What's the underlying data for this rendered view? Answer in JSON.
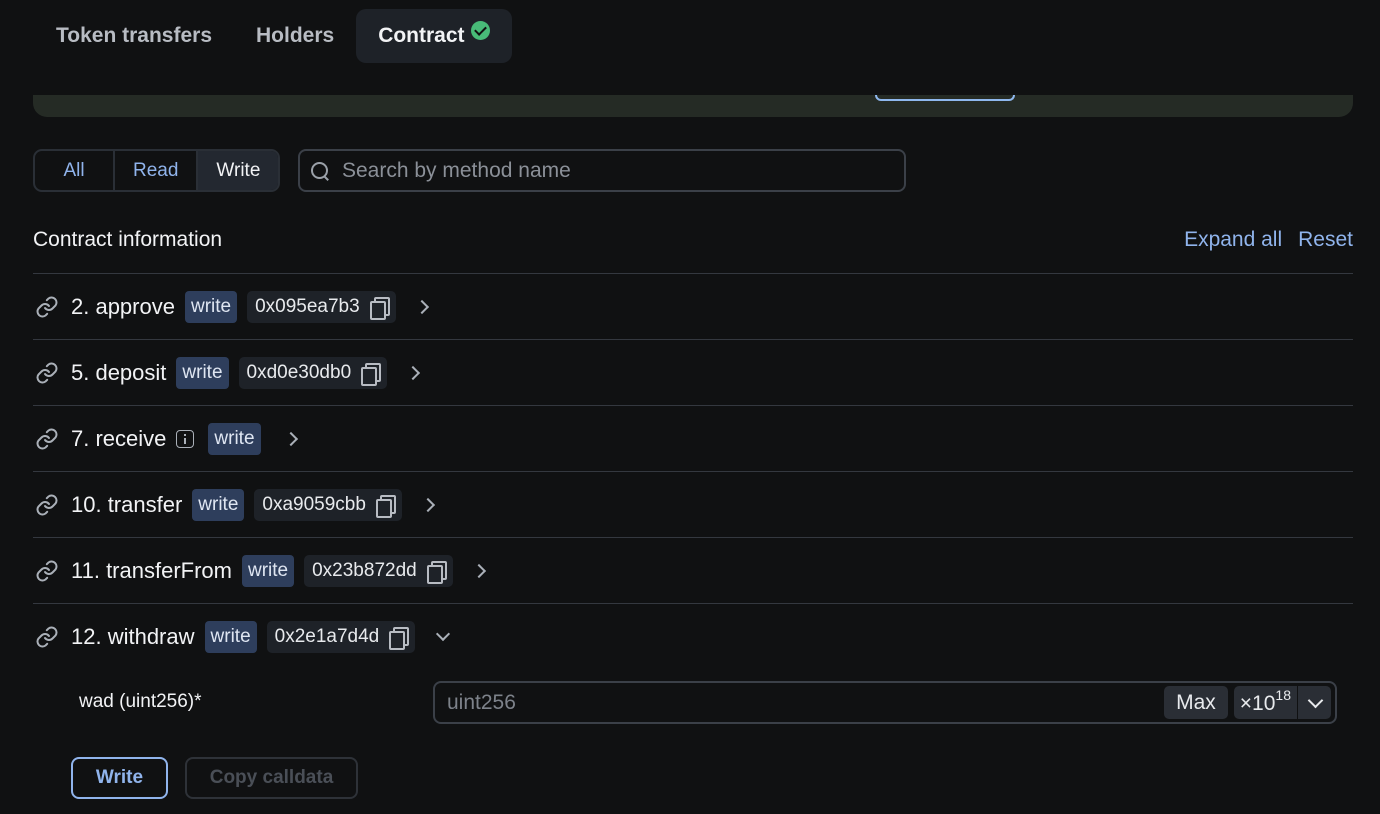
{
  "tabs": [
    {
      "label": "Token transfers"
    },
    {
      "label": "Holders"
    },
    {
      "label": "Contract",
      "verified": true
    }
  ],
  "filter": {
    "all": "All",
    "read": "Read",
    "write": "Write",
    "active": "Write"
  },
  "search": {
    "placeholder": "Search by method name"
  },
  "section": {
    "title": "Contract information",
    "expand_all": "Expand all",
    "reset": "Reset"
  },
  "methods": [
    {
      "name": "2. approve",
      "badge": "write",
      "signature": "0x095ea7b3"
    },
    {
      "name": "5. deposit",
      "badge": "write",
      "signature": "0xd0e30db0"
    },
    {
      "name": "7. receive",
      "badge": "write",
      "signature": ""
    },
    {
      "name": "10. transfer",
      "badge": "write",
      "signature": "0xa9059cbb"
    },
    {
      "name": "11. transferFrom",
      "badge": "write",
      "signature": "0x23b872dd"
    },
    {
      "name": "12. withdraw",
      "badge": "write",
      "signature": "0x2e1a7d4d",
      "expanded": true
    }
  ],
  "withdraw_form": {
    "param_label": "wad (uint256)*",
    "input_placeholder": "uint256",
    "max_label": "Max",
    "multiplier_base": "×10",
    "multiplier_exp": "18",
    "write_button": "Write",
    "copy_calldata_button": "Copy calldata"
  },
  "colors": {
    "background": "#101112",
    "accent": "#90b4ec",
    "badge_bg": "#2e3e5c",
    "verified": "#48bb78"
  }
}
